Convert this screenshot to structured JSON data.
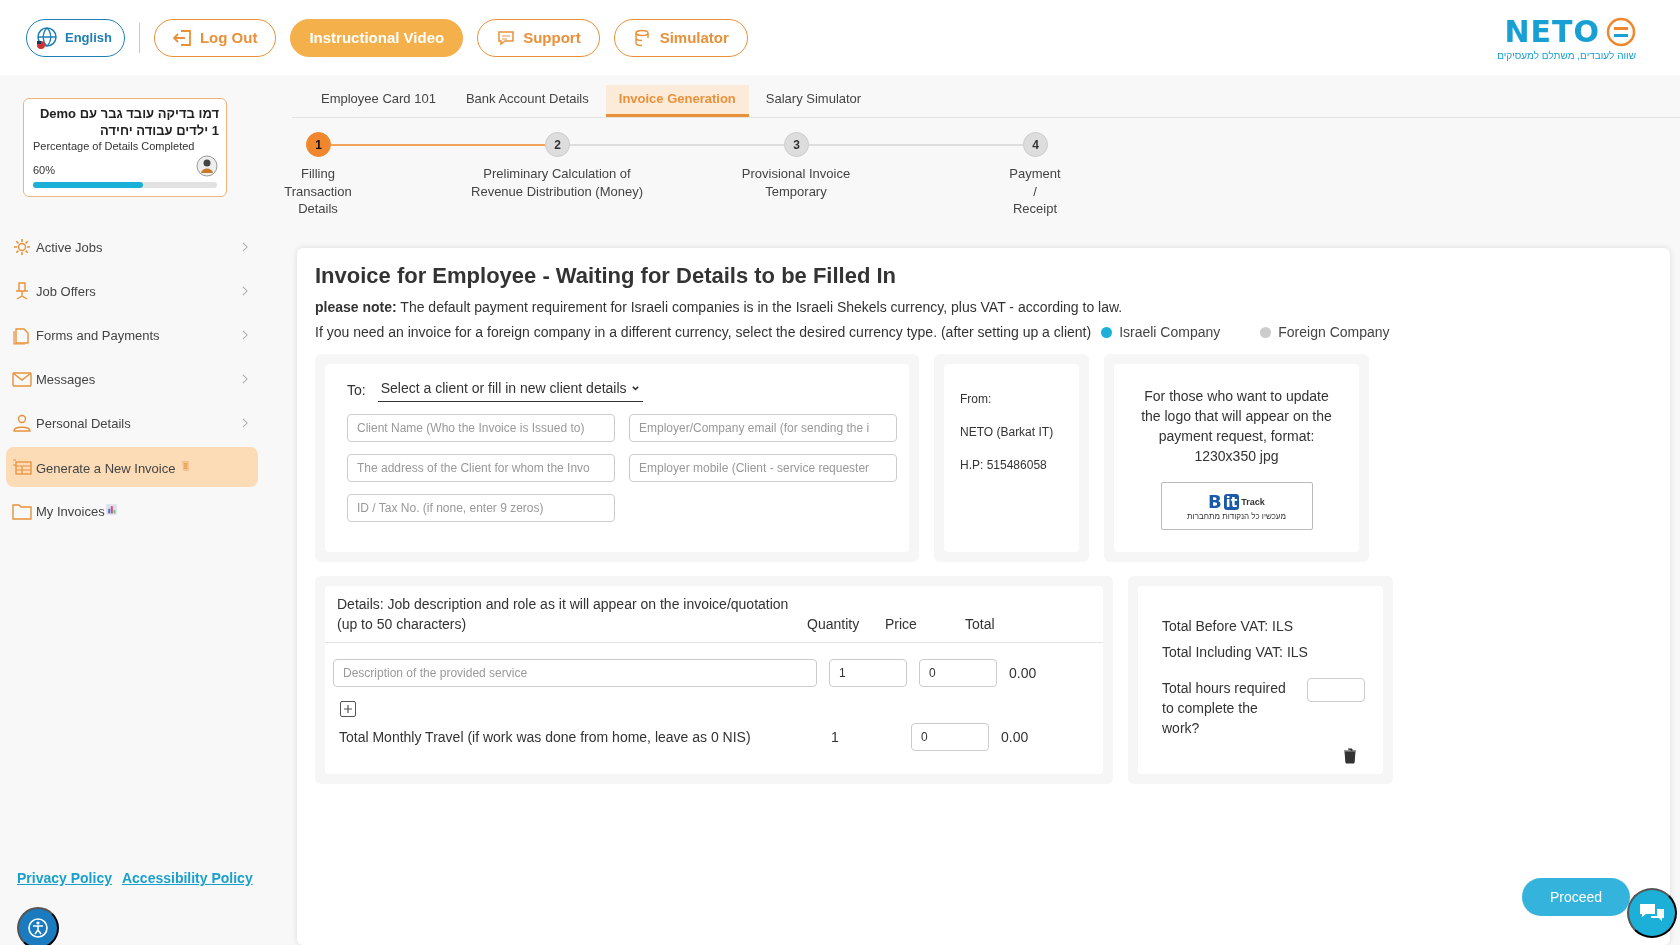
{
  "header": {
    "language": "English",
    "buttons": [
      {
        "label": "Log Out",
        "kind": "outline"
      },
      {
        "label": "Instructional Video",
        "kind": "filled"
      },
      {
        "label": "Support",
        "kind": "outline"
      },
      {
        "label": "Simulator",
        "kind": "outline"
      }
    ],
    "logo": {
      "name": "NETO",
      "tagline": "שווה לעובדים, משתלם למעסיקים"
    }
  },
  "profile": {
    "name": "דמו בדיקה עובד גבר עם Demo 1 ילדים עבודה יחידה",
    "subtitle": "Percentage of Details Completed",
    "percent": "60%",
    "level": 0.6
  },
  "sidebar": {
    "items": [
      {
        "label": "Active Jobs",
        "expandable": true,
        "selected": false
      },
      {
        "label": "Job Offers",
        "expandable": true,
        "selected": false
      },
      {
        "label": "Forms and Payments",
        "expandable": true,
        "selected": false
      },
      {
        "label": "Messages",
        "expandable": true,
        "selected": false
      },
      {
        "label": "Personal Details",
        "expandable": true,
        "selected": false
      },
      {
        "label": "Generate a New Invoice",
        "expandable": false,
        "selected": true
      },
      {
        "label": "My Invoices",
        "expandable": false,
        "selected": false
      }
    ],
    "links": [
      "Privacy Policy",
      "Accessibility Policy"
    ]
  },
  "tabs": [
    {
      "label": "Employee Card 101",
      "selected": false
    },
    {
      "label": "Bank Account Details",
      "selected": false
    },
    {
      "label": "Invoice Generation",
      "selected": true
    },
    {
      "label": "Salary Simulator",
      "selected": false
    }
  ],
  "steps": [
    {
      "number": "1",
      "label_lines": [
        "Filling",
        "Transaction",
        "Details"
      ],
      "selected": true
    },
    {
      "number": "2",
      "label_lines": [
        "Preliminary Calculation of",
        "Revenue Distribution (Money)"
      ],
      "selected": false
    },
    {
      "number": "3",
      "label_lines": [
        "Provisional Invoice",
        "Temporary"
      ],
      "selected": false
    },
    {
      "number": "4",
      "label_lines": [
        "Payment",
        "/",
        "Receipt"
      ],
      "selected": false
    }
  ],
  "invoice": {
    "title": "Invoice for Employee - Waiting for Details to be Filled In",
    "note": "**please note:** The default payment requirement for Israeli companies is in the Israeli Shekels currency, plus VAT - according to law.",
    "currency_prompt": "If you need an invoice for a foreign company in a different currency, select the desired currency type. (after setting up a client)",
    "currency_options": [
      {
        "label": "Israeli Company",
        "selected": true
      },
      {
        "label": "Foreign Company",
        "selected": false
      }
    ],
    "to_label": "To:",
    "client_select": "Select a client or fill in new client details",
    "client_fields": [
      {
        "placeholder": "Client Name (Who the Invoice is Issued to)"
      },
      {
        "placeholder": "Employer/Company email (for sending the i"
      },
      {
        "placeholder": "The address of the Client for whom the Invo"
      },
      {
        "placeholder": "Employer mobile (Client - service requester"
      },
      {
        "placeholder": "ID / Tax No. (if none, enter 9 zeros)"
      }
    ],
    "from": [
      "From:",
      "NETO (Barkat IT)",
      "H.P: 515486058"
    ],
    "logo_note": "For those who want to update the logo that will appear on the payment request, format: 1230x350 jpg",
    "logo_preview": {
      "mark_a": "B",
      "mark_b": "it",
      "word": "Track",
      "tagline": "מעכשיו כל הנקודות מתחברות"
    },
    "columns": [
      "Details: Job description and role as it will appear on the invoice/quotation (up to 50 characters)",
      "Quantity",
      "Price",
      "Total"
    ],
    "line": {
      "placeholder": "Description of the provided service",
      "quantity": "1",
      "price": "0",
      "total": "0.00"
    },
    "travel": {
      "label": "Total Monthly Travel (if work was done from home, leave as 0 NIS)",
      "quantity": "1",
      "price": "0",
      "total": "0.00"
    },
    "totals": [
      {
        "label": "Total Before VAT:",
        "value": "ILS"
      },
      {
        "label": "Total Including VAT:",
        "value": "ILS"
      }
    ],
    "hours_label": "Total hours required to complete the work?",
    "proceed": "Proceed"
  }
}
